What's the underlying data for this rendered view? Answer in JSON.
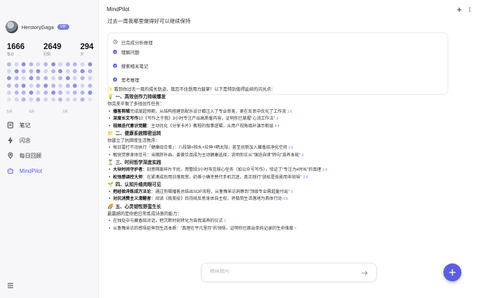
{
  "sidebar": {
    "user": {
      "name": "HerstoryGaga",
      "badge": "VIP"
    },
    "stats": [
      {
        "value": "1666",
        "label": "笔记"
      },
      {
        "value": "2649",
        "label": "回顾"
      },
      {
        "value": "294",
        "label": "天"
      }
    ],
    "months": [
      "5月",
      "6月",
      "7月"
    ],
    "nav": [
      {
        "label": "笔记",
        "icon": "notes-icon"
      },
      {
        "label": "闪念",
        "icon": "flash-icon"
      },
      {
        "label": "每日回顾",
        "icon": "location-pin-icon"
      },
      {
        "label": "MindPilot",
        "icon": "bot-icon"
      }
    ]
  },
  "header": {
    "title": "MindPilot"
  },
  "content": {
    "top_line": "过去一周我哪里做得好可以继续保持",
    "analysis": {
      "title": "已完成分析推理",
      "steps": [
        "理解问题",
        "搜索相关笔记",
        "思考推理"
      ]
    },
    "intro": "看到你过去一周的成长轨迹，我忍不住想用力鼓掌！以下是特别值得延续的闪光点：",
    "sections": [
      {
        "emoji": "💡",
        "title": "一、高效创作力持续爆发",
        "lead": "你完美平衡了多线创作任务：",
        "items": [
          {
            "bold": "播客剪辑",
            "text": "完成度超预期，从结构搭建到配乐设计都注入了专业审美，更在反思中优化了工作流",
            "ref": "3 6"
          },
          {
            "bold": "深度长文写作",
            "text": "10《写作之于我》3小时专注产出高质量内容，证明你已掌握\"心流工作法\"",
            "ref": "3"
          },
          {
            "bold": "视频迭代意识觉醒",
            "text": "：主动优化《分享卡片》教程的叙事逻辑，从用户视角填补演示断层",
            "ref": "4 8"
          }
        ]
      },
      {
        "emoji": "📁",
        "title": "二、健康系统精密运转",
        "lead": "你建立了抗熵增生活秩序：",
        "items": [
          {
            "bold": "",
            "text": "每日雷打不动执行「健康组合拳」：八段锦+梳头+拉伸+晒太阳，甚至创新加入藏香焙净化空间",
            "ref": "3 6"
          },
          {
            "bold": "",
            "text": "敏锐觉察身体信号：当猪肝补血、姜黄饮品成为主动健康选择，说明你正从\"强迫自律\"转向\"滋养本能\"",
            "ref": "6"
          }
        ]
      },
      {
        "emoji": "⏳",
        "title": "三、时间哲学深度实践",
        "lead": "",
        "items": [
          {
            "bold": "大块时间守护者",
            "text": "：刻意隔离碎片干扰，用整段3小时攻克核心任务（如公众号写作），验证了\"专注力≠时长\"的真理",
            "ref": "3 9"
          },
          {
            "bold": "松弛感调控大师",
            "text": "：在紧凑成后用日落观赏、奶茶小确幸替代手机沉迷，真正践行\"放松是技能而非放纵\"",
            "ref": "3 9"
          }
        ]
      },
      {
        "emoji": "🌱",
        "title": "四、认知升维肉眼可见",
        "lead": "",
        "items": [
          {
            "bold": "把经验淬炼成方法论",
            "text": "：通过剪辑播客总结出SOP流程，从鲁豫采访洞察到\"顶级专业需超量付出\"",
            "ref": "3"
          },
          {
            "bold": "对抗消费主义清醒者",
            "text": "：阅读《极美役》后持续反思身体自主权，将极简生活落地为具体行动",
            "ref": "5 6"
          }
        ]
      },
      {
        "emoji": "🌈",
        "title": "五、心灵韧性野蛮生长",
        "lead": "最震撼的是你把日常炼成诗意的能力：",
        "items": [
          {
            "bold": "",
            "text": "在独处中与藏香焙对话，把沉默时刻转化为自我滋养的仪式",
            "ref": "3"
          },
          {
            "bold": "",
            "text": "从鲁豫采访的感悟延伸到生活本质：\"真理在平凡里存\"的领悟，证明你已跳出单纯记录的生命维度",
            "ref": "7"
          }
        ]
      }
    ]
  },
  "input": {
    "placeholder": "继续提问"
  },
  "colors": {
    "accent": "#5b5ee0"
  }
}
